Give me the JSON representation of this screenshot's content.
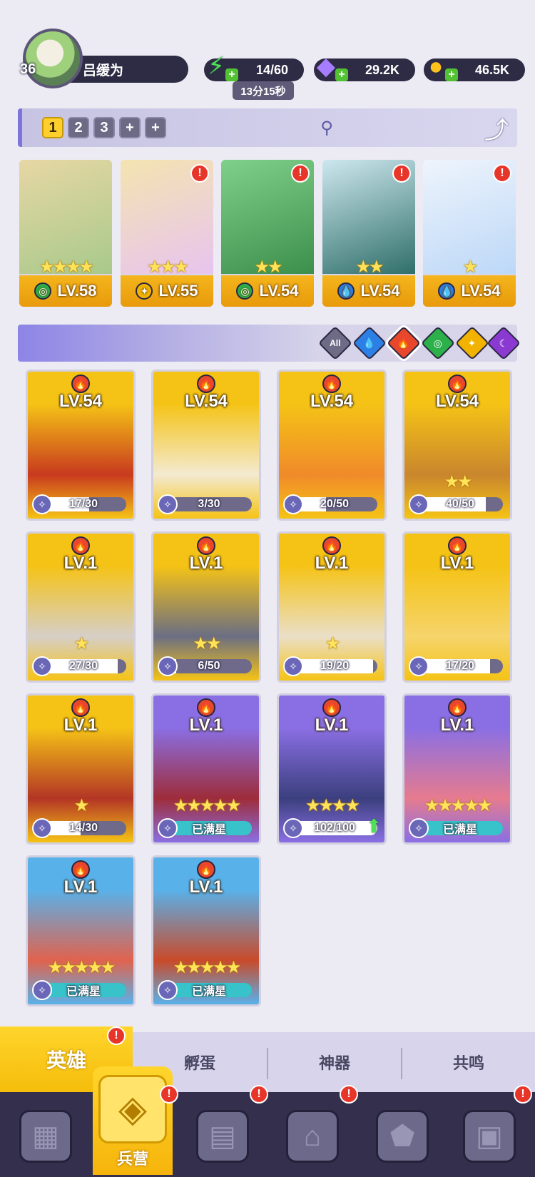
{
  "player": {
    "level": "36",
    "name": "吕缓为"
  },
  "resources": {
    "energy": "14/60",
    "energy_timer": "13分15秒",
    "gems": "29.2K",
    "gold": "46.5K"
  },
  "team_bar": {
    "slots": [
      "1",
      "2",
      "3",
      "+",
      "+"
    ],
    "active_slot": "1"
  },
  "team": [
    {
      "level": "LV.58",
      "stars": "★★★★",
      "element": "wind",
      "alert": false,
      "colors": [
        "#a8c98a",
        "#e7d7a5"
      ]
    },
    {
      "level": "LV.55",
      "stars": "★★★",
      "element": "light",
      "alert": true,
      "colors": [
        "#e7c4ef",
        "#f4e4b0"
      ]
    },
    {
      "level": "LV.54",
      "stars": "★★",
      "element": "wind",
      "alert": true,
      "colors": [
        "#3c8f4b",
        "#7fd08a"
      ]
    },
    {
      "level": "LV.54",
      "stars": "★★",
      "element": "water",
      "alert": true,
      "colors": [
        "#2f6f6a",
        "#cde7ef"
      ]
    },
    {
      "level": "LV.54",
      "stars": "★",
      "element": "water",
      "alert": true,
      "colors": [
        "#bcd8f7",
        "#eef4fc"
      ]
    }
  ],
  "filters": [
    "All",
    "water",
    "fire",
    "wind",
    "light",
    "dark"
  ],
  "selected_filter": "fire",
  "heroes": [
    {
      "level": "LV.54",
      "stars": "",
      "progress": "17/30",
      "fraction": 0.57,
      "bg": [
        "#f5c316",
        "#c83a1e"
      ]
    },
    {
      "level": "LV.54",
      "stars": "",
      "progress": "3/30",
      "fraction": 0.1,
      "bg": [
        "#f5c316",
        "#f3ead0"
      ]
    },
    {
      "level": "LV.54",
      "stars": "",
      "progress": "20/50",
      "fraction": 0.4,
      "bg": [
        "#f5c316",
        "#f08a2a"
      ]
    },
    {
      "level": "LV.54",
      "stars": "★★",
      "progress": "40/50",
      "fraction": 0.8,
      "bg": [
        "#f5c316",
        "#c9862d"
      ]
    },
    {
      "level": "LV.1",
      "stars": "★",
      "progress": "27/30",
      "fraction": 0.9,
      "bg": [
        "#f5c316",
        "#d6cfc7"
      ]
    },
    {
      "level": "LV.1",
      "stars": "★★",
      "progress": "6/50",
      "fraction": 0.12,
      "bg": [
        "#f5c316",
        "#6b6e83"
      ]
    },
    {
      "level": "LV.1",
      "stars": "★",
      "progress": "19/20",
      "fraction": 0.95,
      "bg": [
        "#f5c316",
        "#eadfc8"
      ]
    },
    {
      "level": "LV.1",
      "stars": "",
      "progress": "17/20",
      "fraction": 0.85,
      "bg": [
        "#f5c316",
        "#f5d46b"
      ]
    },
    {
      "level": "LV.1",
      "stars": "★",
      "progress": "14/30",
      "fraction": 0.47,
      "bg": [
        "#f5c316",
        "#b33525"
      ]
    },
    {
      "level": "LV.1",
      "stars": "★★★★★",
      "progress": "已满星",
      "fraction": 1,
      "maxed": true,
      "bg": [
        "#8a6fe4",
        "#9e2c3a"
      ]
    },
    {
      "level": "LV.1",
      "stars": "★★★★",
      "progress": "102/100",
      "fraction": 1,
      "upgrade": true,
      "bg": [
        "#8a6fe4",
        "#3b3f7e"
      ]
    },
    {
      "level": "LV.1",
      "stars": "★★★★★",
      "progress": "已满星",
      "fraction": 1,
      "maxed": true,
      "bg": [
        "#8a6fe4",
        "#e67b8f"
      ]
    },
    {
      "level": "LV.1",
      "stars": "★★★★★",
      "progress": "已满星",
      "fraction": 1,
      "maxed": true,
      "bg": [
        "#59b1ea",
        "#e0634e"
      ]
    },
    {
      "level": "LV.1",
      "stars": "★★★★★",
      "progress": "已满星",
      "fraction": 1,
      "maxed": true,
      "bg": [
        "#59b1ea",
        "#c94a2a"
      ]
    }
  ],
  "subtabs": [
    "英雄",
    "孵蛋",
    "神器",
    "共鸣"
  ],
  "bottom_nav": [
    {
      "name": "cards",
      "label": "",
      "alert": false
    },
    {
      "name": "barracks",
      "label": "兵营",
      "alert": true
    },
    {
      "name": "book",
      "label": "",
      "alert": true
    },
    {
      "name": "shop",
      "label": "",
      "alert": true
    },
    {
      "name": "guild",
      "label": "",
      "alert": false
    },
    {
      "name": "quests",
      "label": "",
      "alert": true
    }
  ],
  "icons": {
    "energy": "energy-bolt-icon",
    "gem": "gem-icon",
    "gold": "gold-coin-icon",
    "search": "search-icon",
    "share": "share-icon",
    "alert": "alert-icon",
    "shard": "hero-shard-icon",
    "upgrade": "upgrade-arrow-icon"
  }
}
